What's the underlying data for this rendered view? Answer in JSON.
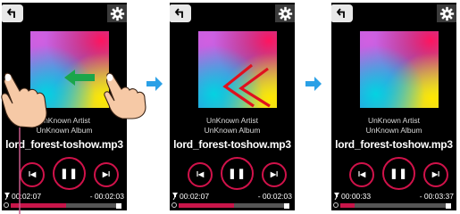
{
  "screens": [
    {
      "artist": "UnKnown Artist",
      "album": "UnKnown Album",
      "filename": "lord_forest-toshow.mp3",
      "elapsed": "00:02:07",
      "remaining": "- 00:02:03",
      "progress": 0.5
    },
    {
      "artist": "UnKnown Artist",
      "album": "UnKnown Album",
      "filename": "lord_forest-toshow.mp3",
      "elapsed": "00:02:07",
      "remaining": "- 00:02:03",
      "progress": 0.5
    },
    {
      "artist": "UnKnown Artist",
      "album": "UnKnown Album",
      "filename": "lord_forest-toshow.mp3",
      "elapsed": "00:00:33",
      "remaining": "- 00:03:37",
      "progress": 0.13
    }
  ],
  "icons": {
    "back": "back-arrow-icon",
    "settings": "gear-icon",
    "previous": "previous-track-icon",
    "pause": "pause-icon",
    "next": "next-track-icon",
    "pin": "pin-icon",
    "loop": "loop-icon",
    "hand": "hand-pointer-icon",
    "transition": "right-arrow-icon"
  },
  "colors": {
    "accent": "#d0124a",
    "swipe_arrow": "#1aa64a",
    "swipe_chevrons": "#e0101e",
    "transition_arrow": "#2aa0e6",
    "background": "#000000"
  }
}
